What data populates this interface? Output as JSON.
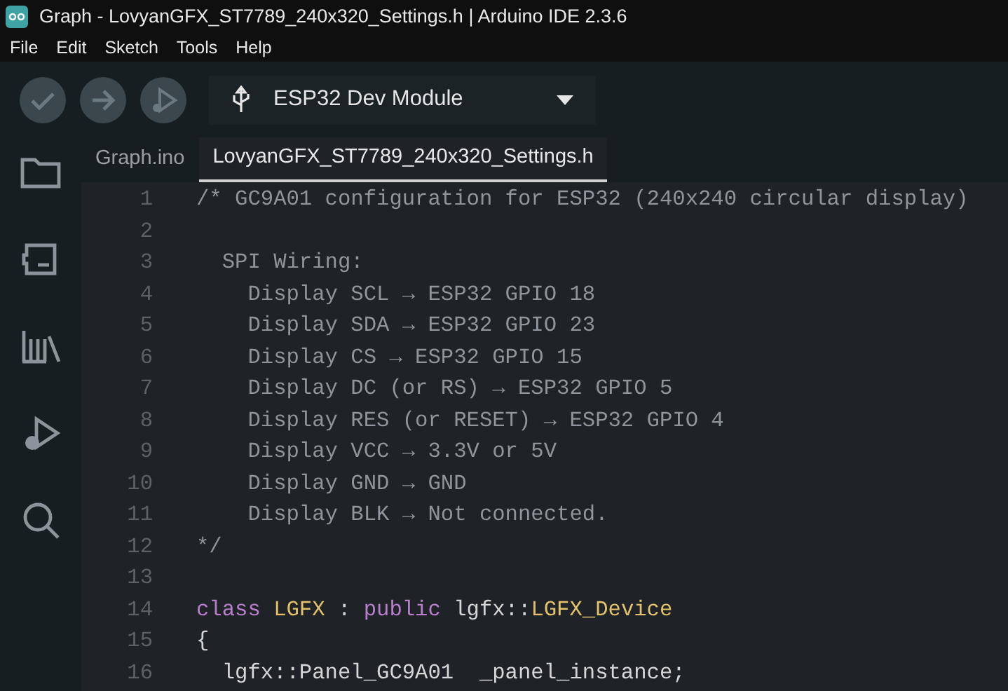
{
  "window": {
    "title": "Graph - LovyanGFX_ST7789_240x320_Settings.h | Arduino IDE 2.3.6"
  },
  "menu": [
    "File",
    "Edit",
    "Sketch",
    "Tools",
    "Help"
  ],
  "toolbar": {
    "buttons": [
      {
        "kind": "verify"
      },
      {
        "kind": "upload"
      },
      {
        "kind": "debug"
      }
    ],
    "board": "ESP32 Dev Module"
  },
  "sidebar": {
    "items": [
      {
        "kind": "folder"
      },
      {
        "kind": "board"
      },
      {
        "kind": "library"
      },
      {
        "kind": "debug"
      },
      {
        "kind": "search"
      }
    ]
  },
  "tabs": [
    {
      "label": "Graph.ino",
      "selected": false
    },
    {
      "label": "LovyanGFX_ST7789_240x320_Settings.h",
      "selected": true
    }
  ],
  "editor": {
    "lines": [
      {
        "number": "1",
        "segments": [
          {
            "kind": "comment",
            "text": "/* GC9A01 configuration for ESP32 (240x240 circular display)"
          }
        ]
      },
      {
        "number": "2"
      },
      {
        "number": "3",
        "segments": [
          {
            "kind": "comment",
            "text": "  SPI Wiring:"
          }
        ]
      },
      {
        "number": "4",
        "segments": [
          {
            "kind": "comment",
            "text": "    Display SCL → ESP32 GPIO 18"
          }
        ]
      },
      {
        "number": "5",
        "segments": [
          {
            "kind": "comment",
            "text": "    Display SDA → ESP32 GPIO 23"
          }
        ]
      },
      {
        "number": "6",
        "segments": [
          {
            "kind": "comment",
            "text": "    Display CS → ESP32 GPIO 15"
          }
        ]
      },
      {
        "number": "7",
        "segments": [
          {
            "kind": "comment",
            "text": "    Display DC (or RS) → ESP32 GPIO 5"
          }
        ]
      },
      {
        "number": "8",
        "segments": [
          {
            "kind": "comment",
            "text": "    Display RES (or RESET) → ESP32 GPIO 4"
          }
        ]
      },
      {
        "number": "9",
        "segments": [
          {
            "kind": "comment",
            "text": "    Display VCC → 3.3V or 5V"
          }
        ]
      },
      {
        "number": "10",
        "segments": [
          {
            "kind": "comment",
            "text": "    Display GND → GND"
          }
        ]
      },
      {
        "number": "11",
        "segments": [
          {
            "kind": "comment",
            "text": "    Display BLK → Not connected."
          }
        ]
      },
      {
        "number": "12",
        "segments": [
          {
            "kind": "comment",
            "text": "*/"
          }
        ]
      },
      {
        "number": "13"
      },
      {
        "number": "14",
        "segments": [
          {
            "kind": "keyword",
            "text": "class "
          },
          {
            "kind": "type",
            "text": "LGFX"
          },
          {
            "kind": "plain",
            "text": " : "
          },
          {
            "kind": "keyword",
            "text": "public"
          },
          {
            "kind": "plain",
            "text": " lgfx::"
          },
          {
            "kind": "type",
            "text": "LGFX_Device"
          }
        ]
      },
      {
        "number": "15",
        "segments": [
          {
            "kind": "plain",
            "text": "{"
          }
        ]
      },
      {
        "number": "16",
        "segments": [
          {
            "kind": "plain",
            "text": "  lgfx::Panel_GC9A01  _panel_instance;"
          }
        ]
      }
    ]
  }
}
